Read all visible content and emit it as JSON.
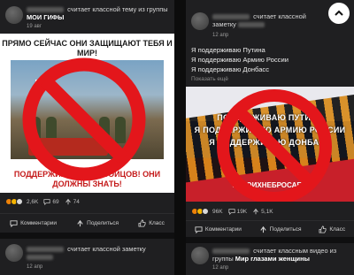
{
  "left": {
    "post1": {
      "header_action": "считает классной тему из группы",
      "group": "МОИ ГИФЫ",
      "date": "19 авг",
      "poster": {
        "top_text": "ПРЯМО СЕЙЧАС ОНИ ЗАЩИЩАЮТ ТЕБЯ И МИР!",
        "bottom_text": "ПОДДЕРЖИМ НАШИХ БОЙЦОВ! ОНИ ДОЛЖНЫ ЗНАТЬ!"
      },
      "stats": {
        "reactions": "2,6K",
        "comments": "69",
        "reshares": "74"
      },
      "actions": {
        "comments": "Комментарии",
        "share": "Поделиться",
        "like": "Класс"
      }
    },
    "post2": {
      "header_action": "считает классной заметку",
      "date": "12 апр"
    }
  },
  "right": {
    "post1": {
      "header_action": "считает классной заметку",
      "date": "12 апр",
      "lines": [
        "Я поддерживаю Путина",
        "Я поддерживаю Армию России",
        "Я поддерживаю Донбасс"
      ],
      "more": "Показать ещё",
      "image": {
        "line1": "ПОДДЕРЖИВАЮ ПУТИНА",
        "line2": "Я ПОДДЕРЖИВАЮ АРМИЮ РОССИИ",
        "line3": "Я ПОДДЕРЖИВАЮ ДОНБАСС",
        "hashtag": "#СВОИХНЕБРОСАЕМ"
      },
      "stats": {
        "reactions": "96K",
        "comments": "19K",
        "reshares": "5,1K"
      },
      "actions": {
        "comments": "Комментарии",
        "share": "Поделиться",
        "like": "Класс"
      }
    },
    "post2": {
      "header_action": "считает классным видео из группы",
      "group": "Мир глазами женщины",
      "date": "12 апр"
    }
  },
  "colors": {
    "ban_red": "#e3161b",
    "accent_orange": "#ee8208",
    "background": "#111111"
  },
  "icons": [
    "scroll-up-icon",
    "comment-icon",
    "share-icon",
    "like-icon",
    "reshare-icon",
    "ban-icon"
  ]
}
